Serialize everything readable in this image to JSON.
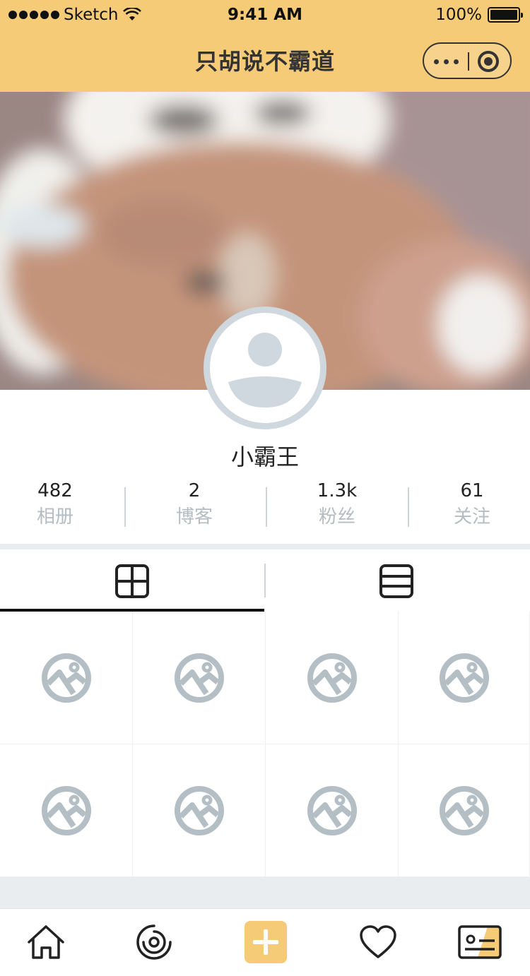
{
  "status_bar": {
    "carrier": "Sketch",
    "time": "9:41 AM",
    "battery": "100%"
  },
  "nav": {
    "title": "只胡说不霸道",
    "capsule_icons": [
      "more-icon",
      "target-icon"
    ]
  },
  "profile": {
    "username": "小霸王"
  },
  "stats": [
    {
      "value": "482",
      "label": "相册"
    },
    {
      "value": "2",
      "label": "博客"
    },
    {
      "value": "1.3k",
      "label": "粉丝"
    },
    {
      "value": "61",
      "label": "关注"
    }
  ],
  "tabs": [
    {
      "icon": "grid-view-icon",
      "active": true
    },
    {
      "icon": "list-view-icon",
      "active": false
    }
  ],
  "gallery": {
    "placeholder_icon": "image-placeholder-icon",
    "count": 8
  },
  "tabbar": [
    {
      "icon": "home-icon"
    },
    {
      "icon": "discover-icon"
    },
    {
      "icon": "add-icon"
    },
    {
      "icon": "heart-icon"
    },
    {
      "icon": "profile-card-icon"
    }
  ],
  "colors": {
    "accent": "#f5cb78",
    "placeholder": "#b4bec5",
    "muted_text": "#b5bcc2"
  }
}
